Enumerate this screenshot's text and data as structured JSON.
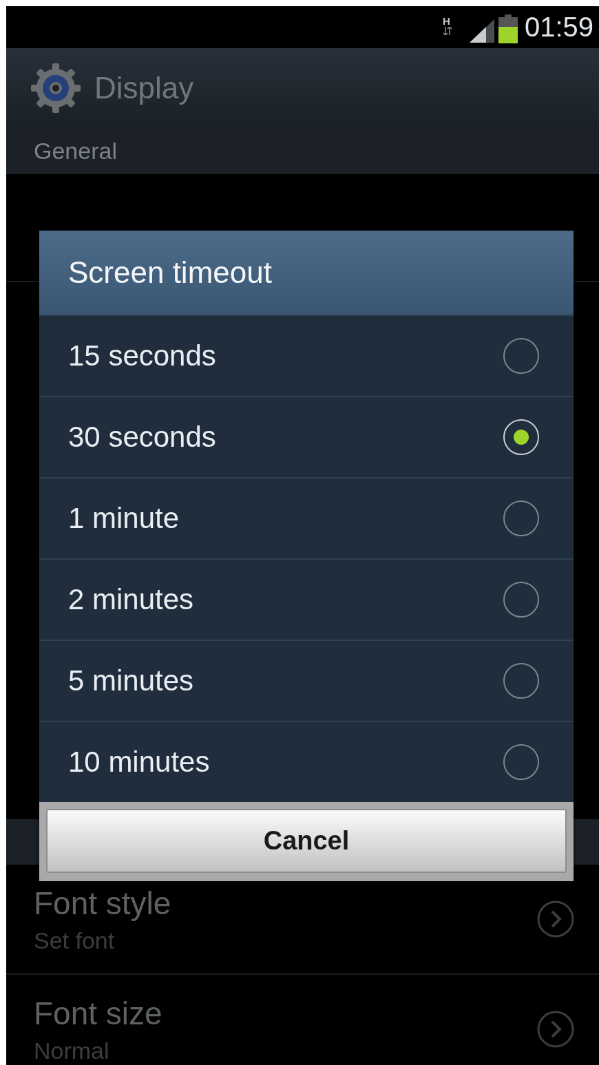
{
  "status_bar": {
    "network": "H",
    "time": "01:59"
  },
  "header": {
    "title": "Display"
  },
  "section": "General",
  "settings": [
    {
      "title": "Font style",
      "subtitle": "Set font"
    },
    {
      "title": "Font size",
      "subtitle": "Normal"
    }
  ],
  "dialog": {
    "title": "Screen timeout",
    "options": [
      {
        "label": "15 seconds",
        "selected": false
      },
      {
        "label": "30 seconds",
        "selected": true
      },
      {
        "label": "1 minute",
        "selected": false
      },
      {
        "label": "2 minutes",
        "selected": false
      },
      {
        "label": "5 minutes",
        "selected": false
      },
      {
        "label": "10 minutes",
        "selected": false
      }
    ],
    "buttons": [
      "Cancel"
    ]
  }
}
